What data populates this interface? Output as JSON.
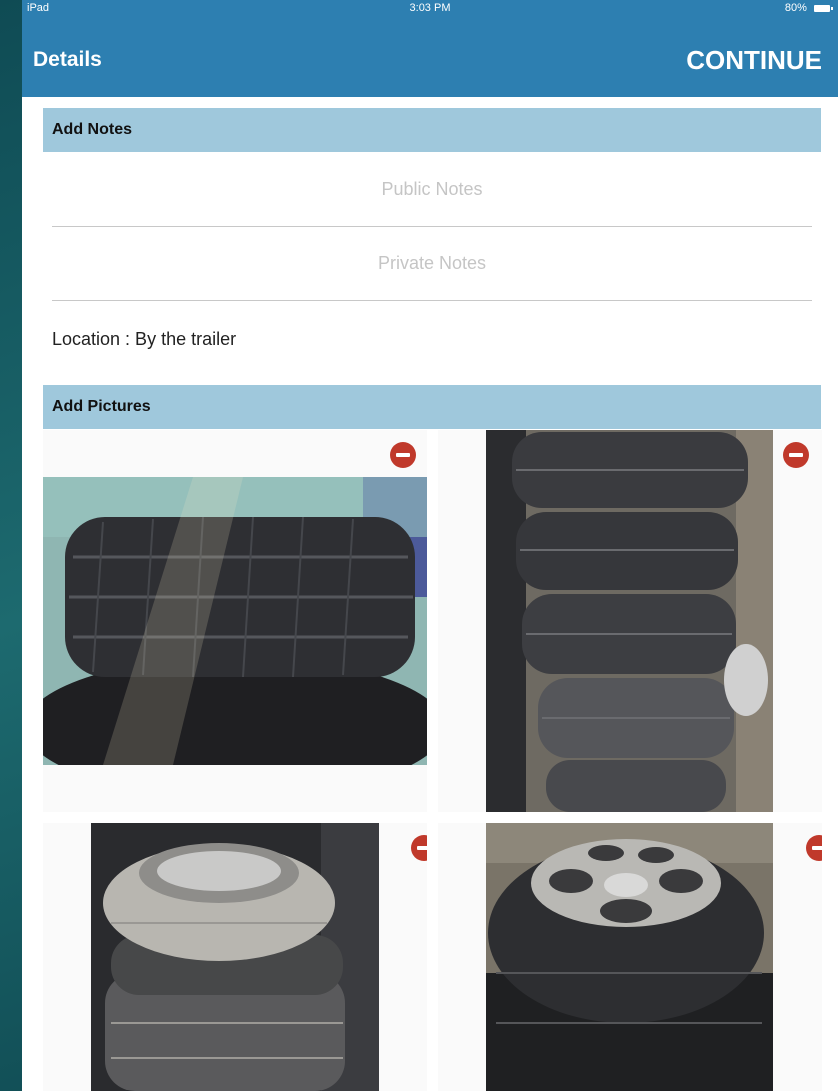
{
  "status_bar": {
    "device": "iPad",
    "time": "3:03 PM",
    "battery": "80%"
  },
  "nav": {
    "title": "Details",
    "continue_label": "CONTINUE"
  },
  "notes_section": {
    "header": "Add Notes",
    "public_placeholder": "Public Notes",
    "private_placeholder": "Private Notes"
  },
  "location": "Location : By the trailer",
  "pictures_section": {
    "header": "Add Pictures"
  },
  "photos": [
    {
      "name": "tire-photo-1",
      "desc_icon": "single-tire-photo"
    },
    {
      "name": "tire-photo-2",
      "desc_icon": "tire-stack-photo"
    },
    {
      "name": "tire-photo-3",
      "desc_icon": "tire-stack-rim-photo"
    },
    {
      "name": "tire-photo-4",
      "desc_icon": "tire-rim-photo"
    }
  ],
  "colors": {
    "nav_bg": "#2d7fb1",
    "section_bg": "#9fc8dc",
    "remove": "#c0392b"
  }
}
